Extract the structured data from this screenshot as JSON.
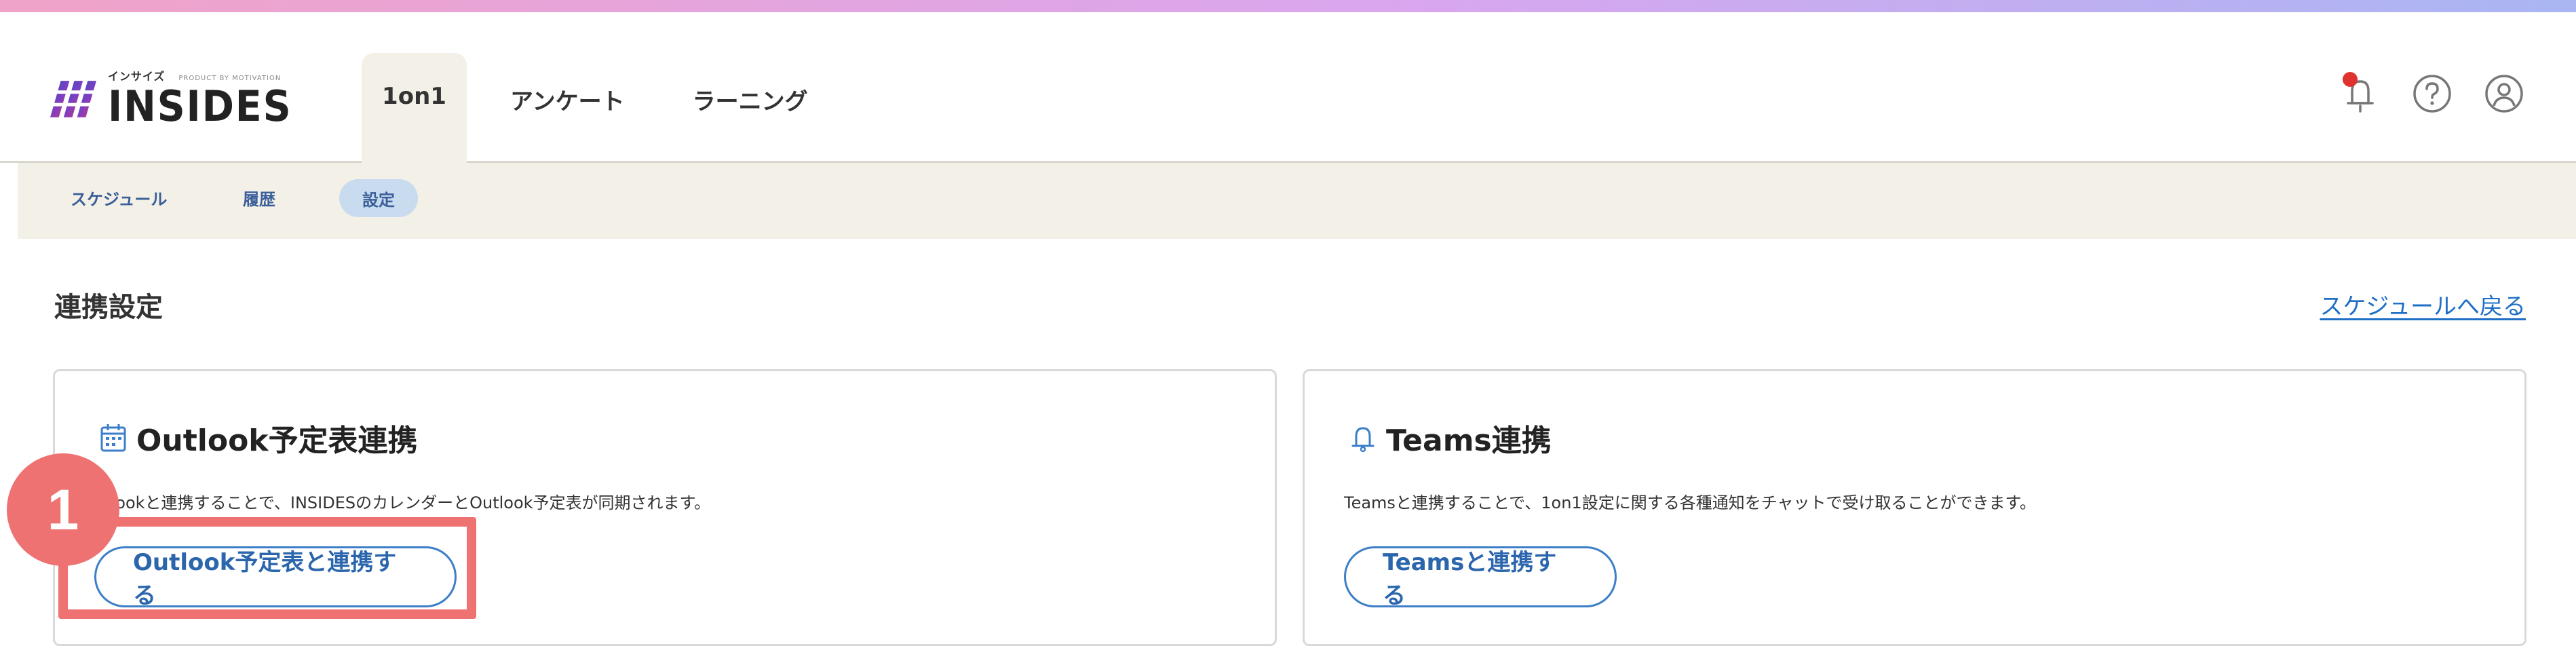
{
  "brand": {
    "name": "INSIDES",
    "kana": "インサイズ",
    "byline": "PRODUCT BY MOTIVATION",
    "accent": "#3c7fc8",
    "annotation_color": "#ef7272"
  },
  "header": {
    "tabs": [
      {
        "label": "1on1",
        "active": true
      },
      {
        "label": "アンケート",
        "active": false
      },
      {
        "label": "ラーニング",
        "active": false
      }
    ],
    "icons": [
      "bell-icon",
      "help-icon",
      "user-account-icon"
    ]
  },
  "subnav": {
    "items": [
      {
        "label": "スケジュール",
        "active": false
      },
      {
        "label": "履歴",
        "active": false
      },
      {
        "label": "設定",
        "active": true
      }
    ]
  },
  "main": {
    "title": "連携設定",
    "back_link": "スケジュールへ戻る",
    "cards": [
      {
        "id": "outlook",
        "icon": "calendar-icon",
        "title": "Outlook予定表連携",
        "description": "utlookと連携することで、INSIDESのカレンダーとOutlook予定表が同期されます。",
        "button": "Outlook予定表と連携する"
      },
      {
        "id": "teams",
        "icon": "bell-icon",
        "title": "Teams連携",
        "description": "Teamsと連携することで、1on1設定に関する各種通知をチャットで受け取ることができます。",
        "button": "Teamsと連携する"
      }
    ]
  },
  "annotation": {
    "step_number": "1"
  }
}
